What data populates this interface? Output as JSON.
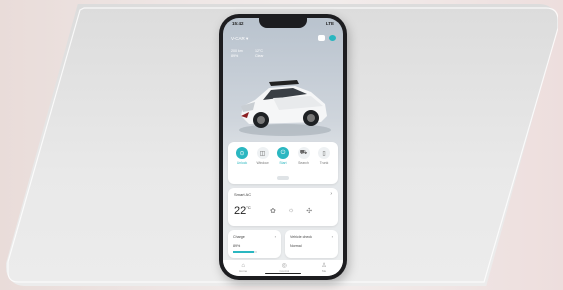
{
  "status": {
    "time": "15:42",
    "icons": "LTE"
  },
  "header": {
    "title": "V-CAR ▾"
  },
  "info": [
    {
      "label": "200 km",
      "value": "89%"
    },
    {
      "label": "12°C",
      "value": "Clear"
    }
  ],
  "controls": [
    {
      "icon": "lock-icon",
      "glyph": "⊙",
      "label": "Unlock",
      "active": true
    },
    {
      "icon": "window-icon",
      "glyph": "◫",
      "label": "Window",
      "active": false
    },
    {
      "icon": "power-icon",
      "glyph": "⏻",
      "label": "Start",
      "active": true
    },
    {
      "icon": "car-icon",
      "glyph": "⛟",
      "label": "Search",
      "active": false
    },
    {
      "icon": "trunk-icon",
      "glyph": "▯",
      "label": "Trunk",
      "active": false
    }
  ],
  "climate": {
    "label": "Smart AC",
    "temp": "22",
    "unit": "°C"
  },
  "battery": {
    "label": "Charge",
    "value": "89%",
    "level": 0.89
  },
  "vehicle_check": {
    "label": "Vehicle check",
    "value": "Normal"
  },
  "nav": [
    {
      "label": "Home",
      "glyph": "⌂"
    },
    {
      "label": "Control",
      "glyph": "◎"
    },
    {
      "label": "Me",
      "glyph": "♙"
    }
  ],
  "colors": {
    "accent": "#2bb7c1"
  }
}
